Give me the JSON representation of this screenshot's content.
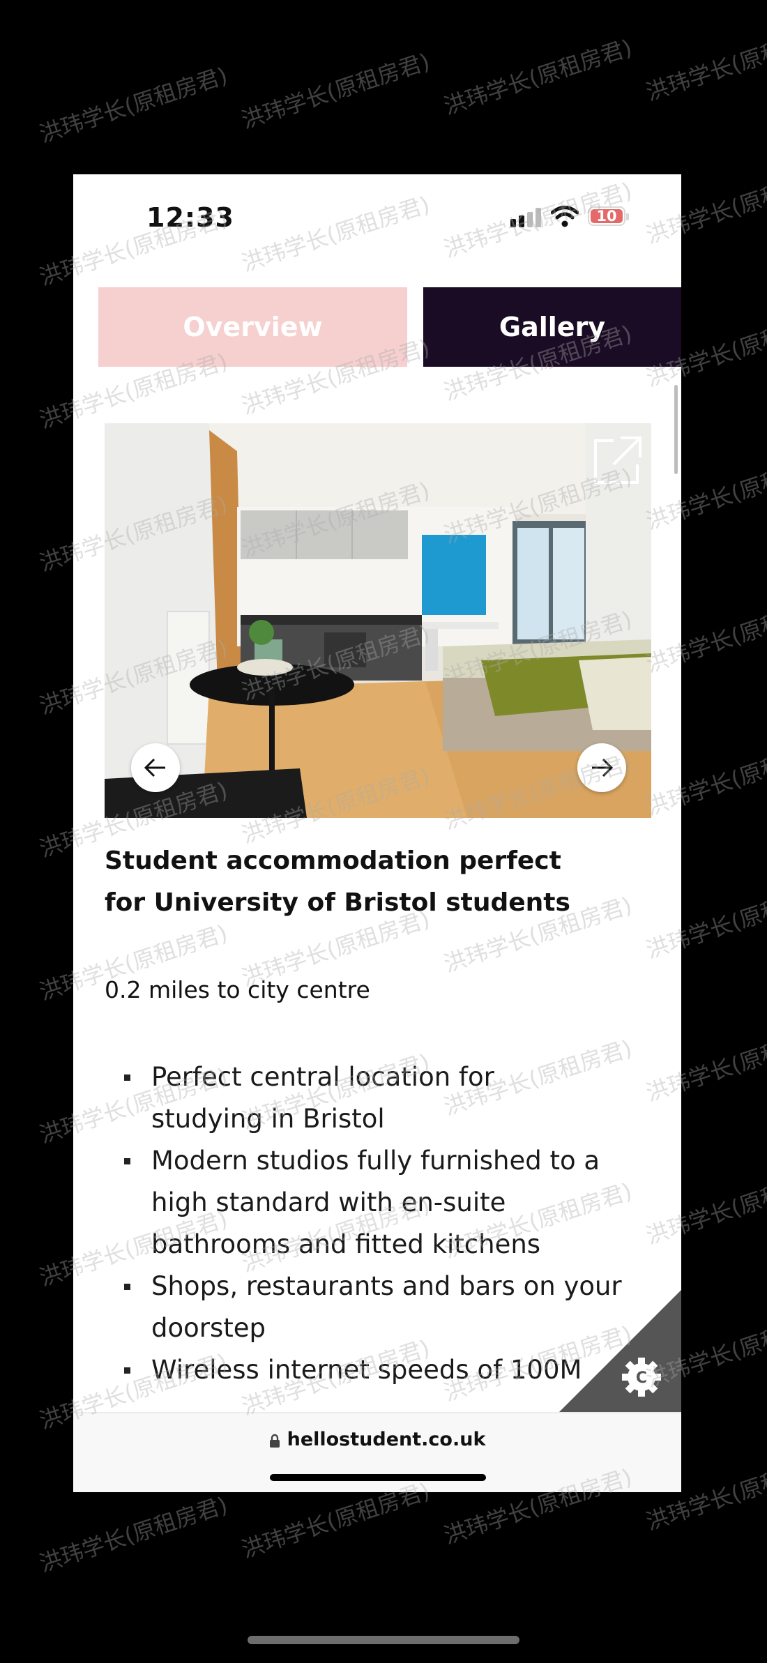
{
  "status_bar": {
    "time": "12:33",
    "battery_level": "10",
    "battery_color": "#e46a6a",
    "icons": [
      "signal-icon",
      "wifi-icon",
      "battery-icon"
    ]
  },
  "tabs": [
    {
      "label": "Overview",
      "active": false
    },
    {
      "label": "Gallery",
      "active": true
    }
  ],
  "gallery": {
    "icons": [
      "expand-icon",
      "arrow-left-icon",
      "arrow-right-icon"
    ]
  },
  "listing": {
    "heading": "Student accommodation perfect\nfor University of Bristol students",
    "distance": "0.2 miles to city centre",
    "features": [
      "Perfect central location for\nstudying in Bristol",
      "Modern studios fully furnished to a\nhigh standard with en-suite\nbathrooms and fitted kitchens",
      "Shops, restaurants and bars on your\ndoorstep",
      "Wireless internet speeds of 100M"
    ]
  },
  "browser": {
    "url": "hellostudent.co.uk"
  },
  "colors": {
    "overview_tab_bg": "#f6cfcf",
    "gallery_tab_bg": "#1a0c24",
    "corner_bg": "#555555"
  },
  "watermark": "洪玮学长(原租房君)"
}
